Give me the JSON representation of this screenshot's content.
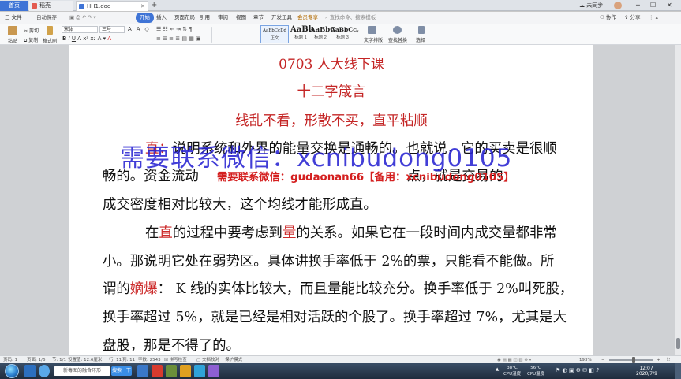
{
  "titlebar": {
    "tab_home": "首页",
    "tab_draft": "稻壳",
    "tab_doc": "HH1.doc",
    "add_tab": "+",
    "login": "未同步",
    "share": "分享",
    "collab": "协作",
    "user_icon": "avatar"
  },
  "menubar": {
    "file": "三 文件",
    "autosave": "自动保存",
    "items": [
      "开始",
      "插入",
      "页面布局",
      "引用",
      "审阅",
      "视图",
      "章节",
      "开发工具",
      "会员专享"
    ],
    "search": "查找命令、搜索模板"
  },
  "ribbon": {
    "paste": "粘贴",
    "cut": "剪切",
    "copy": "复制",
    "format_painter": "格式刷",
    "font_name": "宋体",
    "font_size": "三号",
    "styles": [
      {
        "sample": "AaBbCcDd",
        "name": "正文"
      },
      {
        "sample": "AaBb",
        "name": "标题 1"
      },
      {
        "sample": "AaBbC",
        "name": "标题 2"
      },
      {
        "sample": "AaBbCc",
        "name": "标题 3"
      }
    ],
    "text_layout": "文字排版",
    "find_replace": "查找替换",
    "select": "选择"
  },
  "document": {
    "title1": "0703 人大线下课",
    "title2": "十二字箴言",
    "subtitle": "线乱不看，形散不买，直平粘顺",
    "p1": [
      {
        "red": "直：",
        "text": "说明系统和外界的能量交换是通畅的。也就说，它的买卖是很顺"
      },
      {
        "text": "畅的。资金流动"
      },
      {
        "text2": "点，就是交易的"
      },
      {
        "text": "成交密度相对比较大，这个均线才能形成直。"
      }
    ],
    "p2_line1_a": "在",
    "p2_line1_red1": "直",
    "p2_line1_b": "的过程中要考虑到",
    "p2_line1_red2": "量",
    "p2_line1_c": "的关系。如果它在一段时间内成交量都非常",
    "p2_line2": "小。那说明它处在弱势区。具体讲换手率低于 2%的票，只能看不能做。所",
    "p2_line3_a": "谓的",
    "p2_line3_red": "嫡爆",
    "p2_line3_b": "： K 线的实体比较大，而且量能比较充分。换手率低于 2%叫死股，",
    "p2_line4": "换手率超过 5%，就是已经是相对活跃的个股了。换手率超过 7%，尤其是大",
    "p2_line5": "盘股，那是不得了的。"
  },
  "watermark": {
    "big": "需要联系微信：xcnibudong0105",
    "small": "需要联系微信：gudaonan66【备用：xcnibudong0105】"
  },
  "statusbar": {
    "page": "页码: 1",
    "pages": "页面: 1/6",
    "section": "节: 1/1",
    "setting": "设置值: 12.6厘米",
    "row": "行: 11",
    "col": "列: 11",
    "words": "字数: 2543",
    "spell": "拼写检查",
    "compare": "文档校对",
    "protect": "保护模式",
    "zoom": "193%"
  },
  "taskbar": {
    "search_text": "新毒图的融合环形",
    "search_button": "搜索一下",
    "cpu_temp": "38°C",
    "cpu_label": "CPU温度",
    "mem_temp": "56°C",
    "mem_label": "CPU温度",
    "time": "12:07",
    "date": "2020/7/9"
  },
  "colors": {
    "accent": "#3f74d6",
    "heading_red": "#c42525",
    "watermark_blue": "#2823d2",
    "watermark_red": "#d41f1f"
  }
}
